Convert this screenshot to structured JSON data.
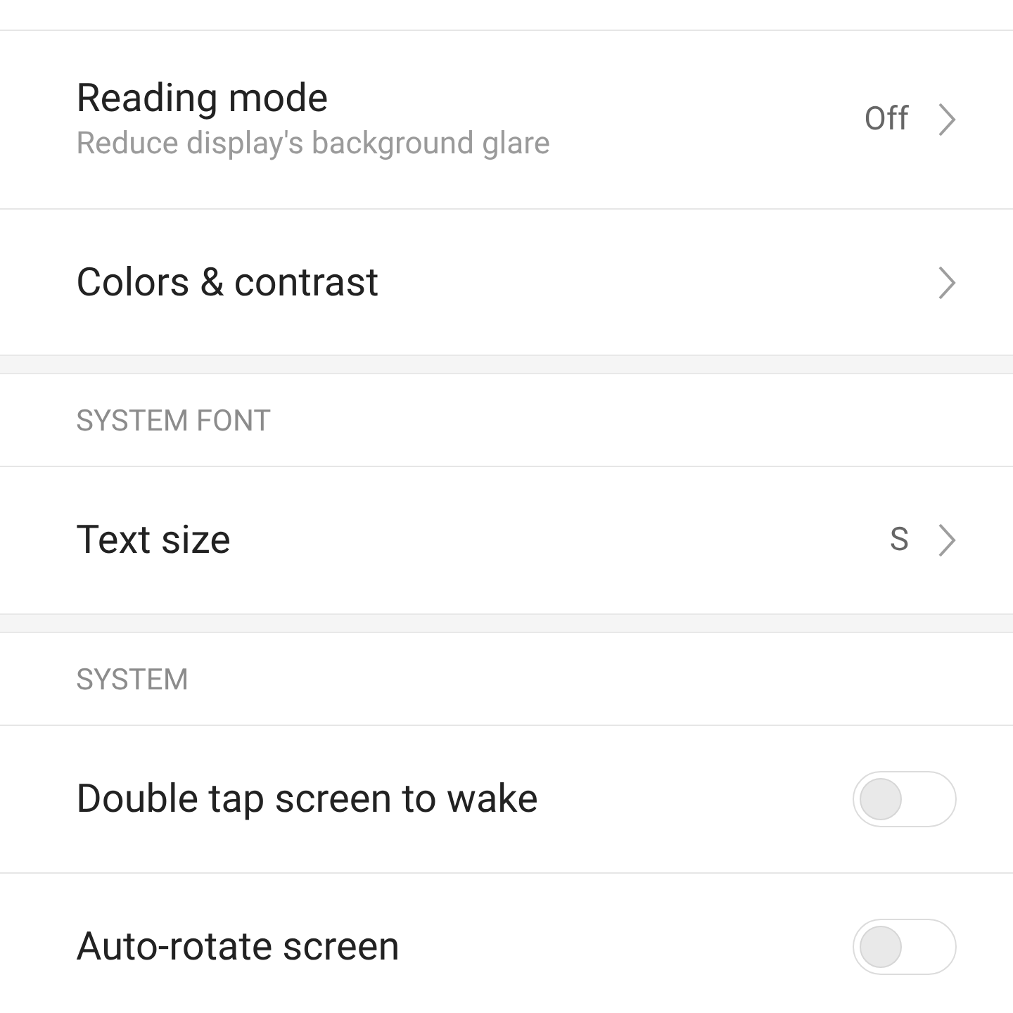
{
  "groups": [
    {
      "items": [
        {
          "kind": "nav",
          "title": "Reading mode",
          "subtitle": "Reduce display's background glare",
          "value": "Off"
        },
        {
          "kind": "nav",
          "title": "Colors & contrast"
        }
      ]
    },
    {
      "header": "SYSTEM FONT",
      "items": [
        {
          "kind": "nav",
          "title": "Text size",
          "value": "S"
        }
      ]
    },
    {
      "header": "SYSTEM",
      "items": [
        {
          "kind": "toggle",
          "title": "Double tap screen to wake",
          "on": false
        },
        {
          "kind": "toggle",
          "title": "Auto-rotate screen",
          "on": false
        }
      ]
    }
  ]
}
